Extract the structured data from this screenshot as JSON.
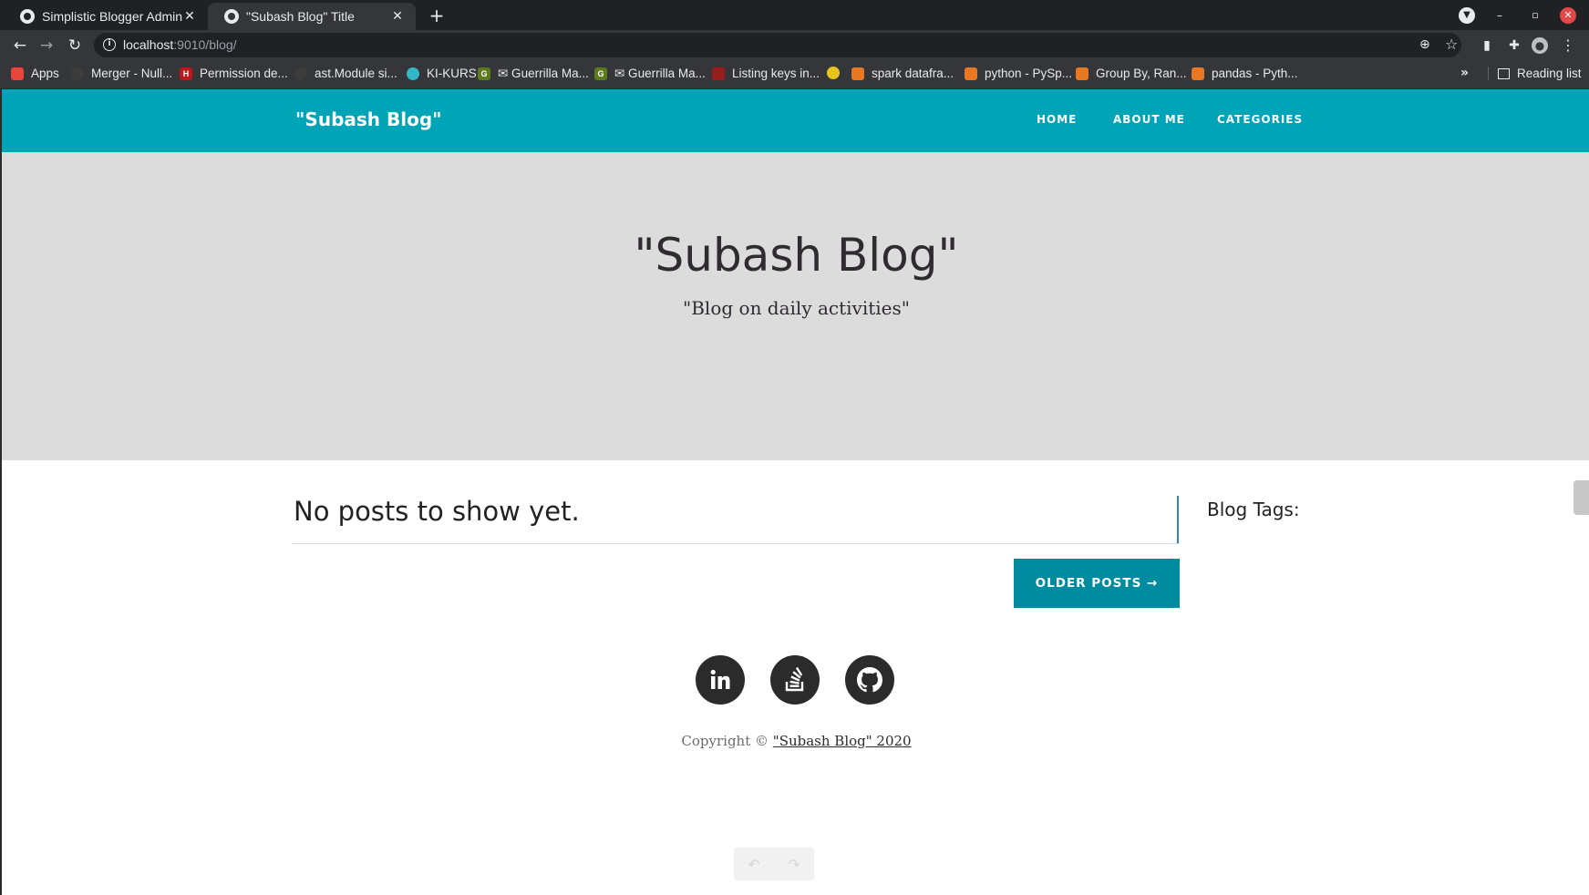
{
  "browser": {
    "tabs": [
      {
        "title": "Simplistic Blogger Admin",
        "active": false
      },
      {
        "title": "\"Subash Blog\" Title",
        "active": true
      }
    ],
    "url_host": "localhost",
    "url_rest": ":9010/blog/",
    "bookmarks": [
      {
        "label": "Apps",
        "icon": "apps-grid-icon",
        "color": "#e8453c"
      },
      {
        "label": "Merger - Null...",
        "icon": "github-icon",
        "color": "#3c3c3c"
      },
      {
        "label": "Permission de...",
        "icon": "h-logo-icon",
        "color": "#c4141b"
      },
      {
        "label": "ast.Module si...",
        "icon": "github-icon",
        "color": "#3c3c3c"
      },
      {
        "label": "KI-KURS",
        "icon": "brain-icon",
        "color": "#33b7c6"
      },
      {
        "label": "✉ Guerrilla Ma...",
        "icon": "g-logo-icon",
        "color": "#5d7a1e"
      },
      {
        "label": "✉ Guerrilla Ma...",
        "icon": "g-logo-icon",
        "color": "#5d7a1e"
      },
      {
        "label": "Listing keys in...",
        "icon": "x-icon",
        "color": "#9b1c1c"
      },
      {
        "label": "",
        "icon": "yellow-smiley-icon",
        "color": "#e8c31a"
      },
      {
        "label": "spark datafra...",
        "icon": "stackoverflow-icon",
        "color": "#e87922"
      },
      {
        "label": "python - PySp...",
        "icon": "stackoverflow-icon",
        "color": "#e87922"
      },
      {
        "label": "Group By, Ran...",
        "icon": "stackoverflow-icon",
        "color": "#e87922"
      },
      {
        "label": "pandas - Pyth...",
        "icon": "stackoverflow-icon",
        "color": "#e87922"
      }
    ],
    "more_label": "»",
    "reading_list": "Reading list"
  },
  "site": {
    "brand": "\"Subash Blog\"",
    "nav": {
      "home": "HOME",
      "about": "ABOUT ME",
      "categories": "CATEGORIES"
    },
    "hero_title": "\"Subash Blog\"",
    "hero_subtitle": "\"Blog on daily activities\"",
    "no_posts": "No posts to show yet.",
    "older_posts": "OLDER POSTS →",
    "sidebar_title": "Blog Tags:",
    "social": [
      {
        "name": "linkedin-icon"
      },
      {
        "name": "stackoverflow-icon"
      },
      {
        "name": "github-icon"
      }
    ],
    "copyright_prefix": "Copyright ©",
    "copyright_link": "\"Subash Blog\" 2020"
  },
  "colors": {
    "nav_bg": "#00a4b7",
    "hero_bg": "#dcdcdc",
    "button_bg": "#008c9e",
    "social_bg": "#2b2b2b"
  }
}
